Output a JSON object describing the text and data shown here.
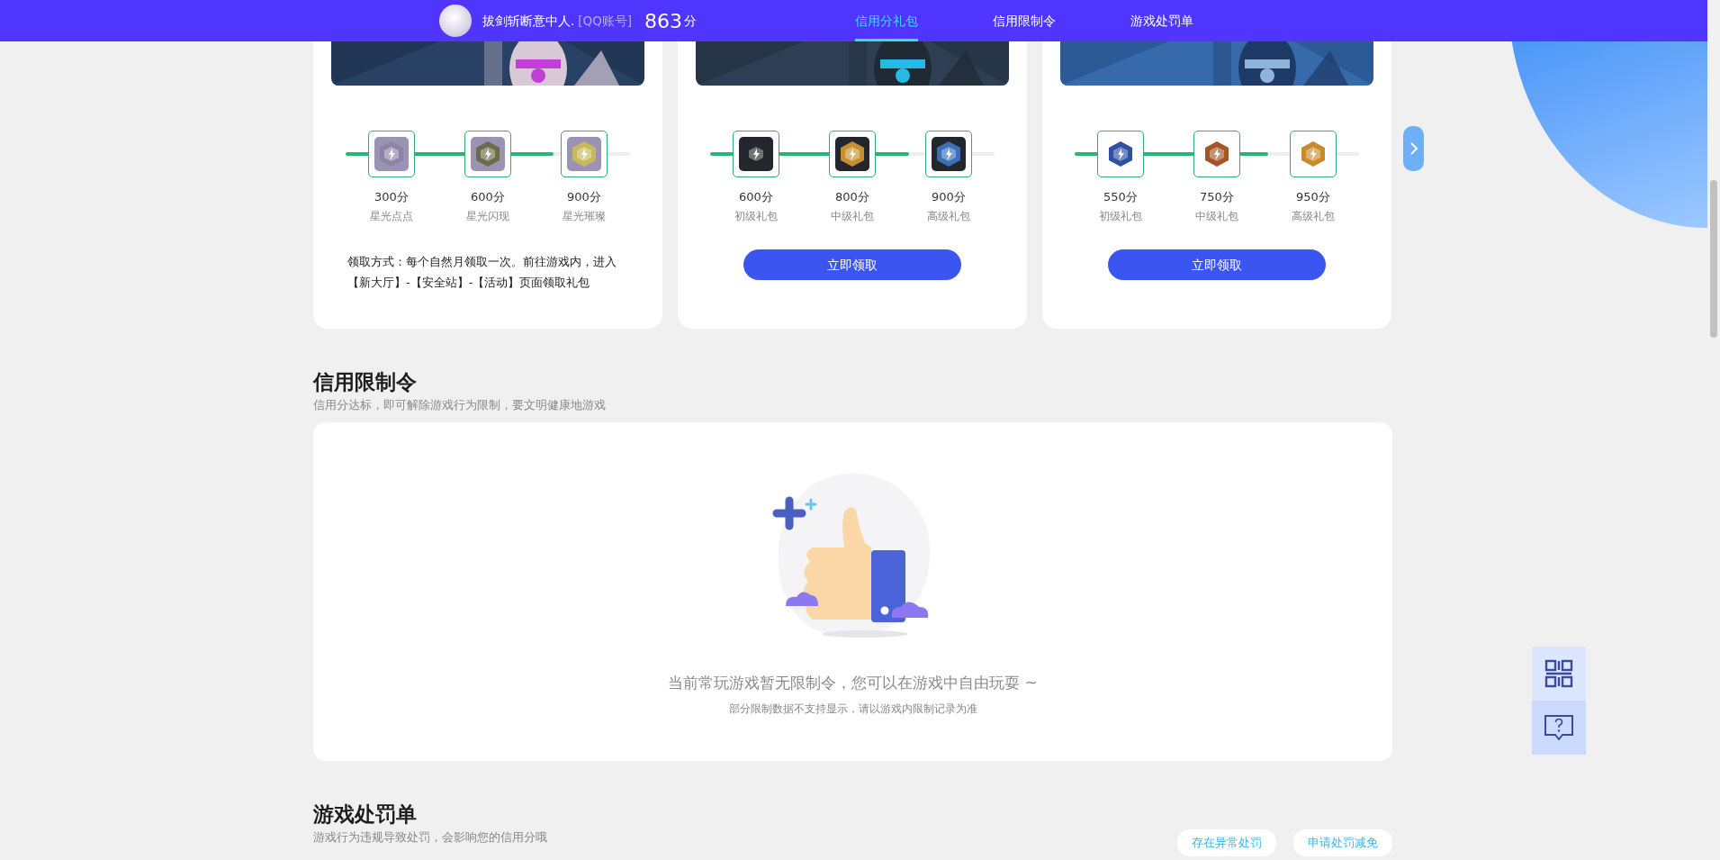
{
  "header": {
    "user_name": "拔剑斩断意中人.",
    "account_type": "[QQ账号]",
    "score": "863",
    "score_unit": "分",
    "tabs": [
      {
        "label": "信用分礼包",
        "selected": true
      },
      {
        "label": "信用限制令",
        "selected": false
      },
      {
        "label": "游戏处罚单",
        "selected": false
      }
    ]
  },
  "gift_cards": [
    {
      "kind": "note",
      "level": 0.73,
      "note": "领取方式：每个自然月领取一次。前往游戏内，进入【新大厅】-【安全站】-【活动】页面领取礼包",
      "rewards": [
        {
          "points": "300分",
          "name": "星光点点"
        },
        {
          "points": "600分",
          "name": "星光闪现"
        },
        {
          "points": "900分",
          "name": "星光璀璨"
        }
      ]
    },
    {
      "kind": "button",
      "level": 0.7,
      "button": "立即领取",
      "rewards": [
        {
          "points": "600分",
          "name": "初级礼包"
        },
        {
          "points": "800分",
          "name": "中级礼包"
        },
        {
          "points": "900分",
          "name": "高级礼包"
        }
      ]
    },
    {
      "kind": "button",
      "level": 0.68,
      "button": "立即领取",
      "rewards": [
        {
          "points": "550分",
          "name": "初级礼包"
        },
        {
          "points": "750分",
          "name": "中级礼包"
        },
        {
          "points": "950分",
          "name": "高级礼包"
        }
      ]
    }
  ],
  "restriction": {
    "title": "信用限制令",
    "subtitle": "信用分达标，即可解除游戏行为限制，要文明健康地游戏",
    "empty_message": "当前常玩游戏暂无限制令，您可以在游戏中自由玩耍 ~",
    "empty_note": "部分限制数据不支持显示，请以游戏内限制记录为准"
  },
  "penalty": {
    "title": "游戏处罚单",
    "subtitle": "游戏行为违规导致处罚，会影响您的信用分哦",
    "buttons": [
      "存在异常处罚",
      "申请处罚减免"
    ]
  }
}
